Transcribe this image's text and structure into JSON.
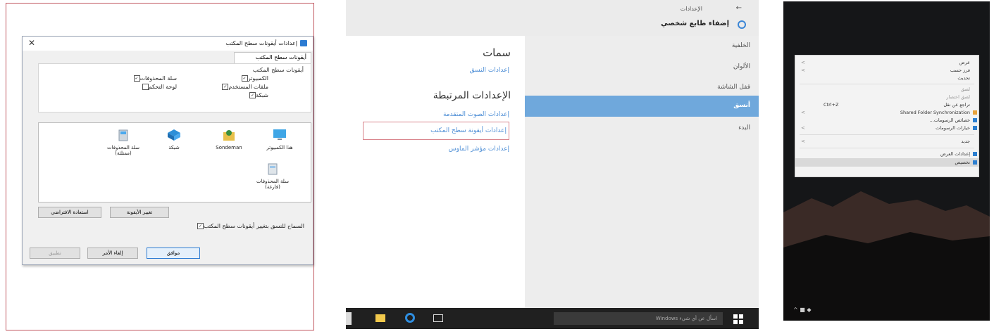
{
  "left": {
    "dialog_title": "إعدادات أيقونات سطح المكتب",
    "close_glyph": "✕",
    "tab_label": "أيقونات سطح المكتب",
    "group_title": "أيقونات سطح المكتب",
    "checkboxes": [
      {
        "label": "الكمبيوتر",
        "checked": true
      },
      {
        "label": "ملفات المستخدم",
        "checked": true
      },
      {
        "label": "شبكة",
        "checked": true
      },
      {
        "label": "سلة المحذوفات",
        "checked": true
      },
      {
        "label": "لوحة التحكم",
        "checked": false
      }
    ],
    "icons": [
      {
        "label": "هذا الكمبيوتر",
        "icon": "monitor-icon"
      },
      {
        "label": "Sondeman",
        "icon": "user-folder-icon"
      },
      {
        "label": "شبكة",
        "icon": "network-icon"
      },
      {
        "label": "سلة المحذوفات (ممتلئة)",
        "icon": "recycle-bin-full-icon"
      },
      {
        "label": "سلة المحذوفات (فارغة)",
        "icon": "recycle-bin-empty-icon"
      }
    ],
    "btn_change_icon": "تغيير الأيقونة",
    "btn_restore_default": "استعادة الافتراضي",
    "theme_checkbox": "السماح للنسق بتغيير أيقونات سطح المكتب",
    "btn_ok": "موافق",
    "btn_cancel": "إلغاء الأمر",
    "btn_apply": "تطبيق"
  },
  "middle": {
    "back_label": "الإعدادات",
    "back_arrow": "←",
    "header_title": "إضفاء طابع شخصي",
    "nav": [
      "الخلفية",
      "الألوان",
      "قفل الشاشة",
      "أنسق",
      "البدء"
    ],
    "selected_nav": "أنسق",
    "section_title": "سمات",
    "theme_settings_link": "إعدادات النسق",
    "related_title": "الإعدادات المرتبطة",
    "related_links": [
      "إعدادات الصوت المتقدمة",
      "إعدادات أيقونة سطح المكتب",
      "إعدادات مؤشر الماوس"
    ],
    "highlighted_link": "إعدادات أيقونة سطح المكتب",
    "taskbar_search": "اسأل عن أي شيء Windows"
  },
  "right": {
    "menu_items": [
      {
        "label": "عرض",
        "arrow": true
      },
      {
        "label": "فرز حسب",
        "arrow": true
      },
      {
        "label": "تحديث",
        "arrow": false
      },
      {
        "label": "لصق",
        "arrow": false
      },
      {
        "label": "لصق اختصار",
        "arrow": false
      },
      {
        "label": "تراجع عن نقل",
        "arrow": false,
        "shortcut": "Ctrl+Z"
      },
      {
        "label": "Shared Folder Synchronization",
        "arrow": true,
        "icon": true
      },
      {
        "label": "خصائص الرسومات...",
        "arrow": false,
        "icon": true
      },
      {
        "label": "خيارات الرسومات",
        "arrow": true,
        "icon": true
      },
      {
        "label": "جديد",
        "arrow": true
      },
      {
        "label": "إعدادات العرض",
        "arrow": false,
        "icon": true
      },
      {
        "label": "تخصيص",
        "arrow": false,
        "icon": true,
        "highlight": true
      }
    ],
    "tray_text": "^ ■ ◆"
  },
  "colors": {
    "accent": "#6fa8dc",
    "link": "#4f8fd6",
    "frame": "#c0565f",
    "dark_bg": "#151618"
  }
}
